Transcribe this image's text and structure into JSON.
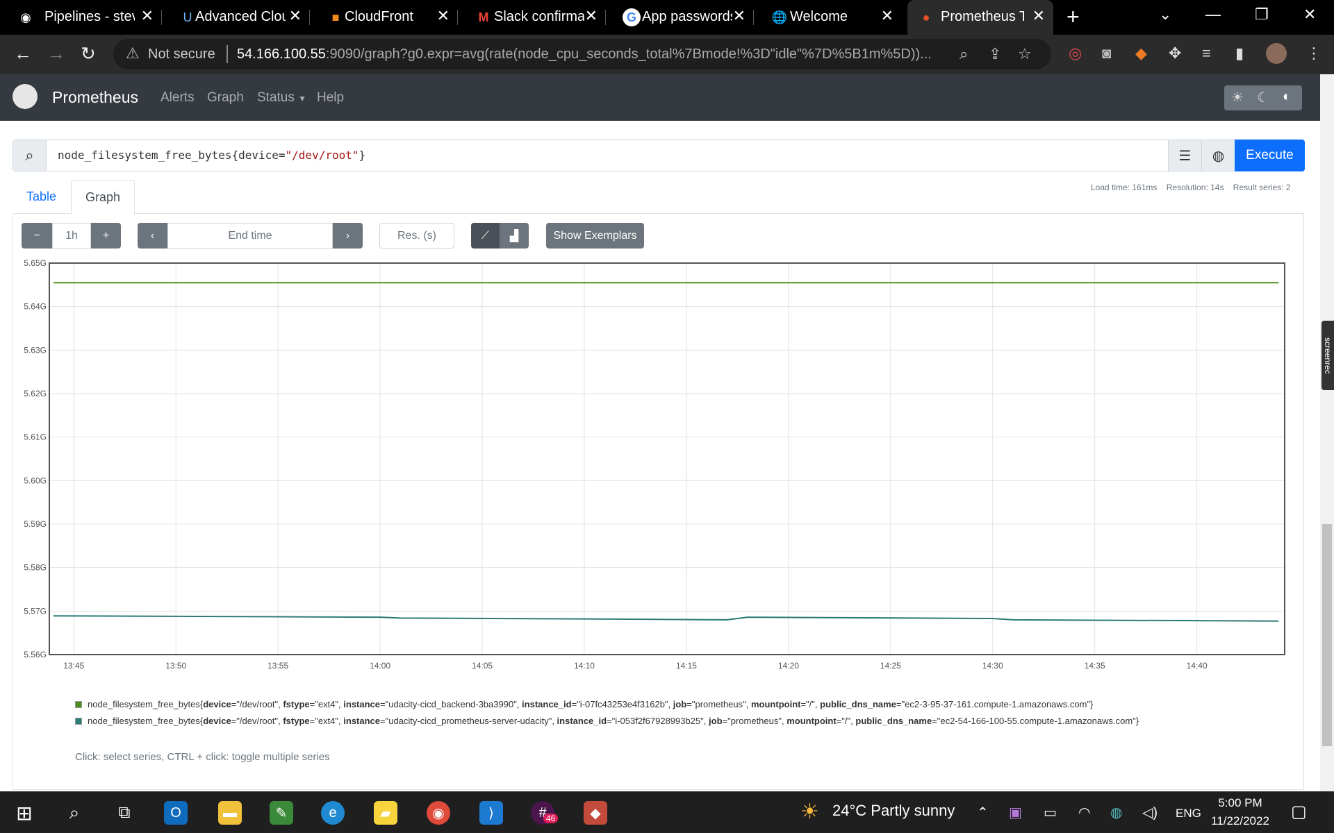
{
  "browser": {
    "tabs": [
      {
        "title": "Pipelines - stev",
        "icon": "circleci-icon"
      },
      {
        "title": "Advanced Clou",
        "icon": "udacity-icon"
      },
      {
        "title": "CloudFront",
        "icon": "aws-icon"
      },
      {
        "title": "Slack confirmat",
        "icon": "gmail-icon"
      },
      {
        "title": "App passwords",
        "icon": "google-icon"
      },
      {
        "title": "Welcome",
        "icon": "globe-icon"
      },
      {
        "title": "Prometheus Ti",
        "icon": "prometheus-icon"
      }
    ],
    "not_secure": "Not secure",
    "url_host": "54.166.100.55",
    "url_path": ":9090/graph?g0.expr=avg(rate(node_cpu_seconds_total%7Bmode!%3D\"idle\"%7D%5B1m%5D))..."
  },
  "app": {
    "name": "Prometheus",
    "nav": [
      "Alerts",
      "Graph",
      "Status",
      "Help"
    ]
  },
  "query": {
    "metric": "node_filesystem_free_bytes",
    "label": "device",
    "value": "\"/dev/root\"",
    "execute": "Execute"
  },
  "stats": {
    "load_time": "Load time: 161ms",
    "resolution": "Resolution: 14s",
    "result_series": "Result series: 2"
  },
  "panel_tabs": [
    "Table",
    "Graph"
  ],
  "controls": {
    "range": "1h",
    "end_time_placeholder": "End time",
    "res_placeholder": "Res. (s)",
    "show_exemplars": "Show Exemplars"
  },
  "chart_data": {
    "type": "line",
    "ylim": [
      5.56,
      5.65
    ],
    "y_ticks": [
      "5.65G",
      "5.64G",
      "5.63G",
      "5.62G",
      "5.61G",
      "5.60G",
      "5.59G",
      "5.58G",
      "5.57G",
      "5.56G"
    ],
    "x_ticks": [
      "13:45",
      "13:50",
      "13:55",
      "14:00",
      "14:05",
      "14:10",
      "14:15",
      "14:20",
      "14:25",
      "14:30",
      "14:35",
      "14:40"
    ],
    "series": [
      {
        "color": "#4d8e1b",
        "x": [
          "13:44",
          "14:44"
        ],
        "values": [
          5.6455,
          5.6455
        ]
      },
      {
        "color": "#2a7a76",
        "x": [
          "13:44",
          "13:50",
          "14:00",
          "14:01",
          "14:10",
          "14:17",
          "14:18",
          "14:30",
          "14:31",
          "14:44"
        ],
        "values": [
          5.5689,
          5.5688,
          5.5686,
          5.5684,
          5.5682,
          5.568,
          5.5686,
          5.5683,
          5.568,
          5.5677
        ]
      }
    ]
  },
  "legend": [
    {
      "color": "#4d8e1b",
      "metric": "node_filesystem_free_bytes",
      "labels": [
        [
          "device",
          "\"/dev/root\""
        ],
        [
          "fstype",
          "\"ext4\""
        ],
        [
          "instance",
          "\"udacity-cicd_backend-3ba3990\""
        ],
        [
          "instance_id",
          "\"i-07fc43253e4f3162b\""
        ],
        [
          "job",
          "\"prometheus\""
        ],
        [
          "mountpoint",
          "\"/\""
        ],
        [
          "public_dns_name",
          "\"ec2-3-95-37-161.compute-1.amazonaws.com\""
        ]
      ]
    },
    {
      "color": "#2a7a76",
      "metric": "node_filesystem_free_bytes",
      "labels": [
        [
          "device",
          "\"/dev/root\""
        ],
        [
          "fstype",
          "\"ext4\""
        ],
        [
          "instance",
          "\"udacity-cicd_prometheus-server-udacity\""
        ],
        [
          "instance_id",
          "\"i-053f2f67928993b25\""
        ],
        [
          "job",
          "\"prometheus\""
        ],
        [
          "mountpoint",
          "\"/\""
        ],
        [
          "public_dns_name",
          "\"ec2-54-166-100-55.compute-1.amazonaws.com\""
        ]
      ]
    }
  ],
  "hint": "Click: select series, CTRL + click: toggle multiple series",
  "screenrec": "screenrec",
  "taskbar": {
    "weather": "24°C  Partly sunny",
    "lang": "ENG",
    "time": "5:00 PM",
    "date": "11/22/2022",
    "slack_badge": "46"
  }
}
